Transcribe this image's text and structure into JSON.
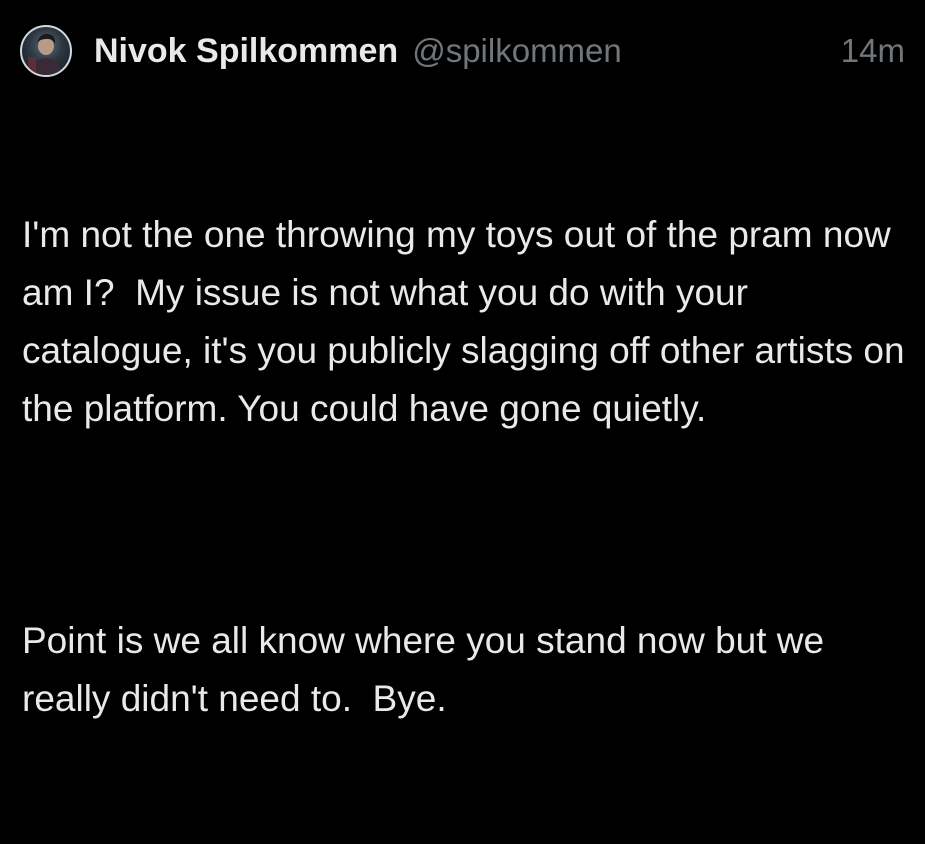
{
  "tweet": {
    "display_name": "Nivok Spilkommen",
    "handle": "@spilkommen",
    "time": "14m",
    "avatar": "user-avatar",
    "paragraphs": [
      "I'm not the one throwing my toys out of the pram now am I?  My issue is not what you do with your catalogue, it's you publicly slagging off other artists on the platform. You could have gone quietly.",
      "Point is we all know where you stand now but we really didn't need to.  Bye."
    ]
  },
  "colors": {
    "background": "#000000",
    "text": "#e7e9ea",
    "secondary_text": "#71767b"
  }
}
